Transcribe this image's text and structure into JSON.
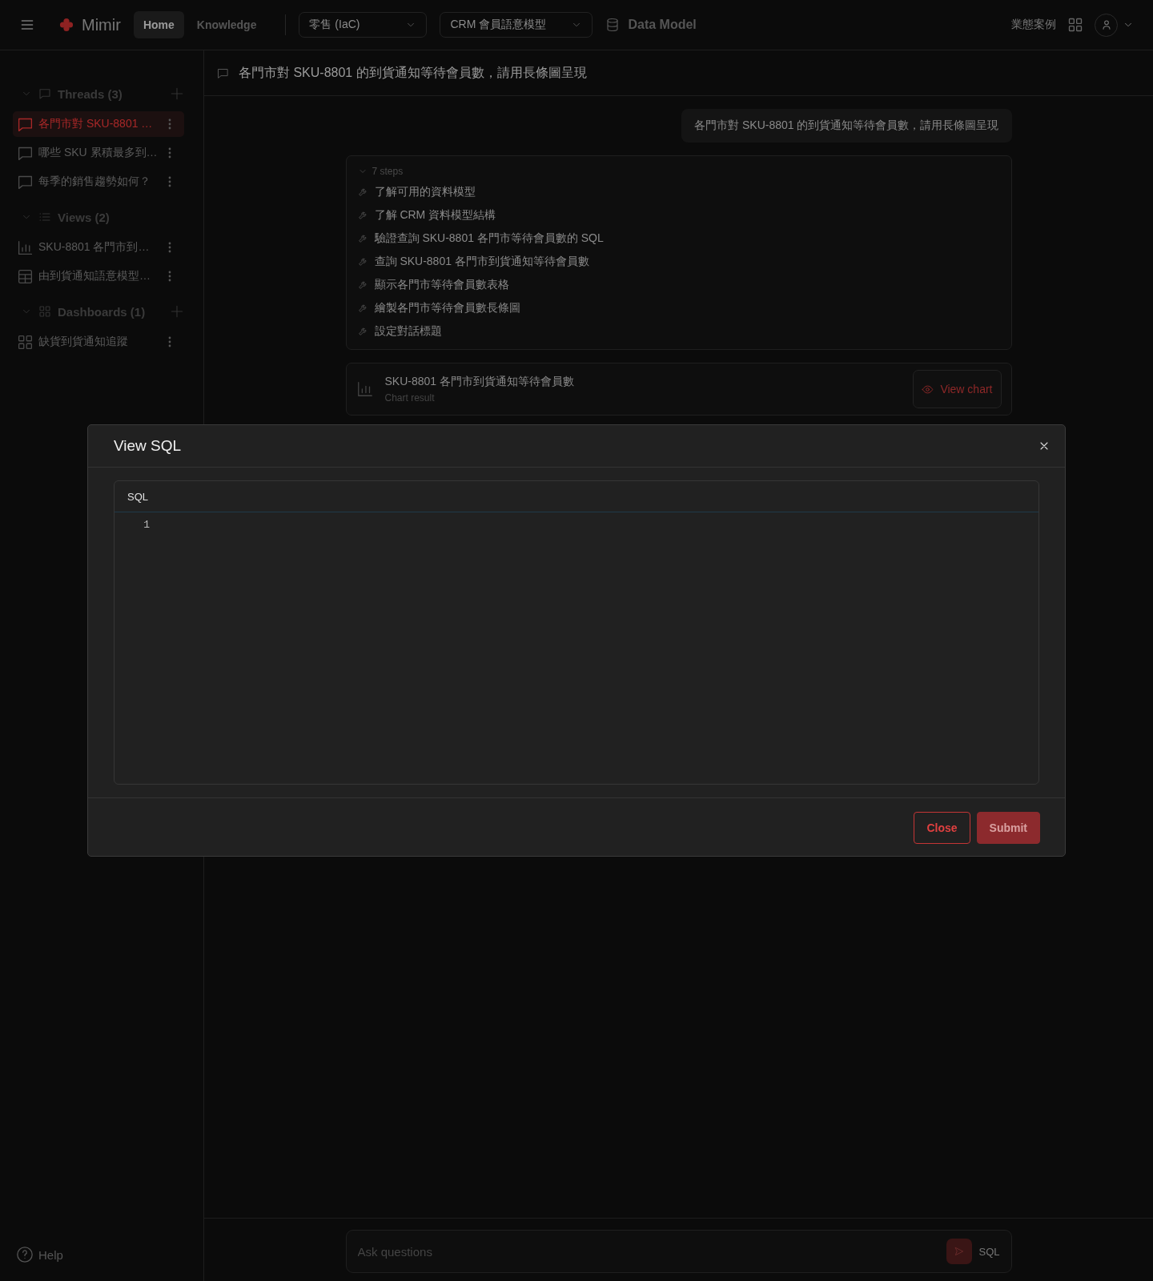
{
  "topbar": {
    "brand": "Mimir",
    "nav": [
      {
        "label": "Home",
        "selected": true
      },
      {
        "label": "Knowledge",
        "selected": false
      }
    ],
    "selects": [
      {
        "value": "零售 (IaC)"
      },
      {
        "value": "CRM 會員語意模型"
      }
    ],
    "data_model": "Data Model",
    "cases": "業態案例"
  },
  "sidebar": {
    "sections": [
      {
        "kind": "threads",
        "title": "Threads (3)",
        "expanded": true,
        "addable": true,
        "items": [
          {
            "kind": "chat",
            "label": "各門市對 SKU-8801 …",
            "selected": true
          },
          {
            "kind": "chat",
            "label": "哪些 SKU 累積最多到…",
            "selected": false
          },
          {
            "kind": "chat",
            "label": "每季的銷售趨勢如何？",
            "selected": false
          }
        ]
      },
      {
        "kind": "views",
        "title": "Views (2)",
        "expanded": true,
        "addable": false,
        "items": [
          {
            "kind": "chart",
            "label": "SKU-8801 各門市到…",
            "selected": false
          },
          {
            "kind": "table",
            "label": "由到貨通知語意模型…",
            "selected": false
          }
        ]
      },
      {
        "kind": "dashboards",
        "title": "Dashboards (1)",
        "expanded": true,
        "addable": true,
        "items": [
          {
            "kind": "dashboard",
            "label": "缺貨到貨通知追蹤",
            "selected": false
          }
        ]
      }
    ],
    "help": "Help"
  },
  "thread": {
    "title": "各門市對 SKU-8801 的到貨通知等待會員數，請用長條圖呈現",
    "question": "各門市對 SKU-8801 的到貨通知等待會員數，請用長條圖呈現",
    "steps": {
      "summary": "7 steps",
      "expanded": true,
      "items": [
        "了解可用的資料模型",
        "了解 CRM 資料模型結構",
        "驗證查詢 SKU-8801 各門市等待會員數的 SQL",
        "查詢 SKU-8801 各門市到貨通知等待會員數",
        "顯示各門市等待會員數表格",
        "繪製各門市等待會員數長條圖",
        "設定對話標題"
      ]
    },
    "result": {
      "title": "SKU-8801 各門市到貨通知等待會員數",
      "subtitle": "Chart result",
      "action": "View chart"
    }
  },
  "composer": {
    "placeholder": "Ask questions",
    "mode": "SQL"
  },
  "modal": {
    "title": "View SQL",
    "editor": {
      "label": "SQL",
      "line_numbers": [
        "1"
      ]
    },
    "buttons": [
      {
        "label": "Close",
        "kind": "secondary"
      },
      {
        "label": "Submit",
        "kind": "primary"
      }
    ]
  }
}
